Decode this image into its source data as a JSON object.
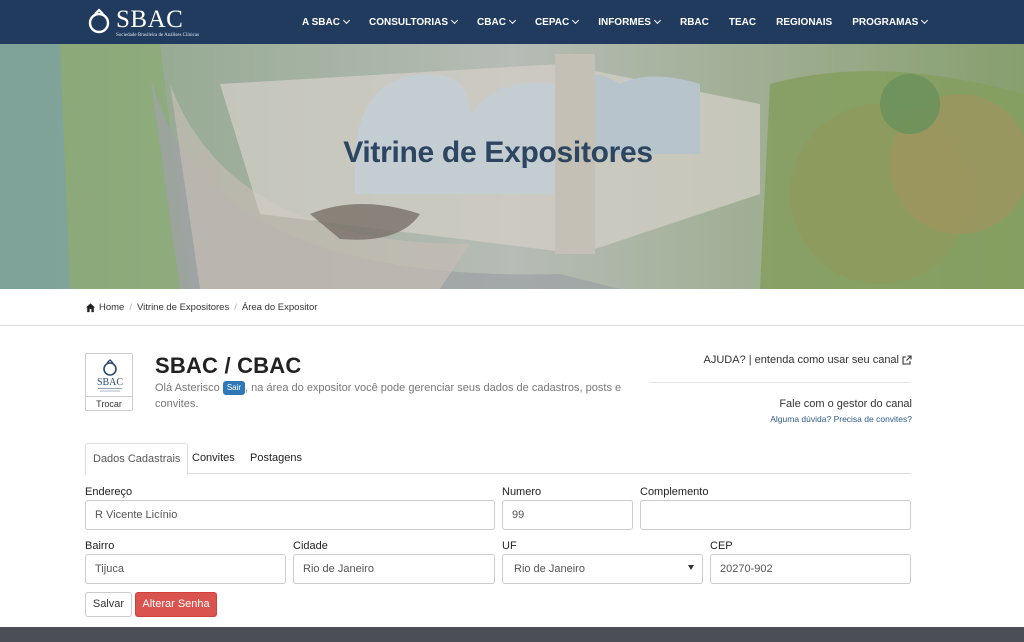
{
  "brand": {
    "name": "SBAC",
    "subtitle": "Sociedade Brasileira de Análises Clínicas"
  },
  "nav": {
    "items": [
      {
        "label": "A SBAC",
        "dropdown": true
      },
      {
        "label": "CONSULTORIAS",
        "dropdown": true
      },
      {
        "label": "CBAC",
        "dropdown": true
      },
      {
        "label": "CEPAC",
        "dropdown": true
      },
      {
        "label": "INFORMES",
        "dropdown": true
      },
      {
        "label": "RBAC",
        "dropdown": false
      },
      {
        "label": "TEAC",
        "dropdown": false
      },
      {
        "label": "REGIONAIS",
        "dropdown": false
      },
      {
        "label": "PROGRAMAS",
        "dropdown": true
      }
    ]
  },
  "hero": {
    "title": "Vitrine de Expositores"
  },
  "breadcrumb": {
    "items": [
      "Home",
      "Vitrine de Expositores",
      "Área do Expositor"
    ]
  },
  "profile": {
    "company": "SBAC / CBAC",
    "welcome_prefix": "Olá Asterisco",
    "logout_label": "Sair",
    "welcome_suffix": ", na área do expositor você pode gerenciar seus dados de cadastros, posts e convites.",
    "avatar_brand": "SBAC",
    "change_logo_label": "Trocar"
  },
  "help": {
    "text": "AJUDA? | entenda como usar seu canal",
    "contact_title": "Fale com o gestor do canal",
    "contact_sub": "Alguma dúvida? Precisa de convites?"
  },
  "tabs": [
    {
      "label": "Dados Cadastrais",
      "active": true
    },
    {
      "label": "Convites",
      "active": false
    },
    {
      "label": "Postagens",
      "active": false
    }
  ],
  "form": {
    "endereco": {
      "label": "Endereço",
      "value": "R Vicente Licínio"
    },
    "numero": {
      "label": "Numero",
      "value": "99"
    },
    "complemento": {
      "label": "Complemento",
      "value": ""
    },
    "bairro": {
      "label": "Bairro",
      "value": "Tijuca"
    },
    "cidade": {
      "label": "Cidade",
      "value": "Rio de Janeiro"
    },
    "uf": {
      "label": "UF",
      "value": "Rio de Janeiro"
    },
    "cep": {
      "label": "CEP",
      "value": "20270-902"
    },
    "save_label": "Salvar",
    "change_password_label": "Alterar Senha"
  },
  "colors": {
    "nav_bg": "#213b5e",
    "hero_title": "#2c4561",
    "primary_badge": "#2f78b7",
    "danger": "#d9534f",
    "footer": "#4b4f55"
  }
}
